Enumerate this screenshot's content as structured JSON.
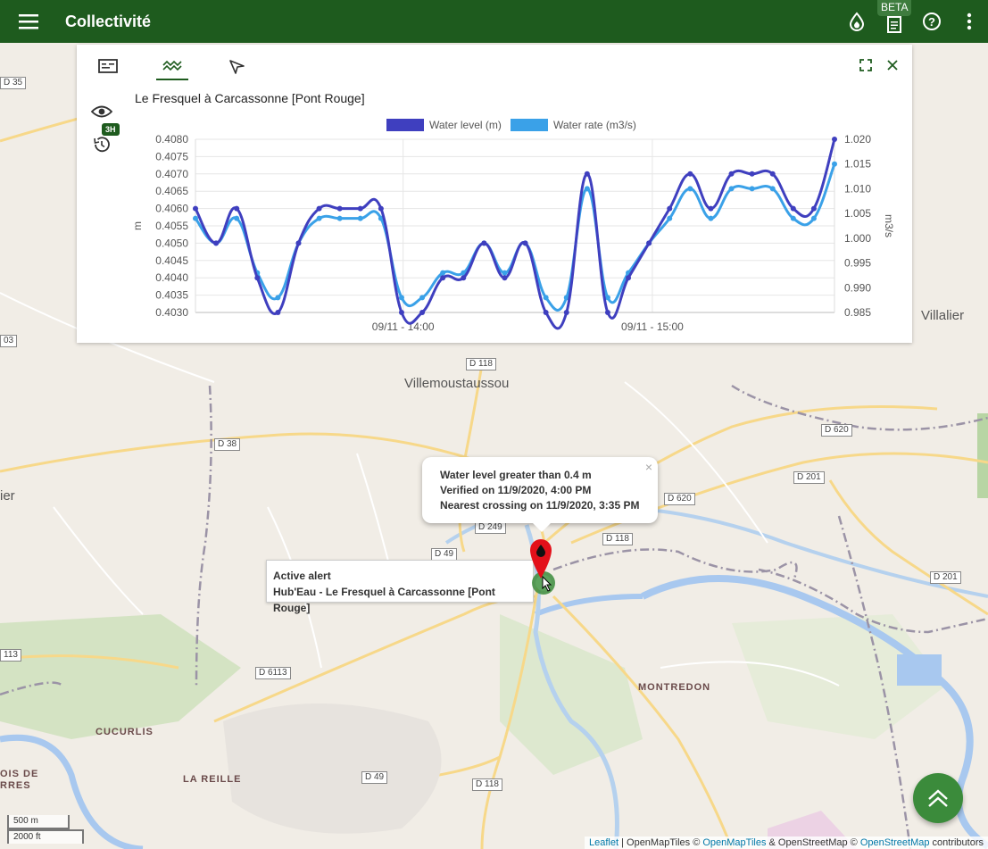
{
  "app": {
    "title": "Collectivité",
    "beta_label": "BETA"
  },
  "panel": {
    "station": "Le Fresquel à Carcassonne [Pont Rouge]",
    "history_badge": "3H"
  },
  "popup": {
    "line1": "Water level greater than 0.4 m",
    "line2": "Verified on 11/9/2020, 4:00 PM",
    "line3": "Nearest crossing on 11/9/2020, 3:35 PM",
    "close": "×"
  },
  "tooltip": {
    "line1": "Active alert",
    "line2": "Hub'Eau - Le Fresquel à Carcassonne [Pont Rouge]"
  },
  "map": {
    "places": {
      "villemoustaussou": "Villemoustaussou",
      "villalier": "Villalier",
      "montredon": "MONTREDON",
      "cucurlis": "CUCURLIS",
      "la_reille": "LA REILLE",
      "bois_de": "OIS DE",
      "barres": "RRES",
      "ier": "ier"
    },
    "roads": {
      "d35": "D 35",
      "d03": "03",
      "d118a": "D 118",
      "d38": "D 38",
      "d620a": "D 620",
      "d201a": "D 201",
      "d620b": "D 620",
      "d249": "D 249",
      "d118b": "D 118",
      "d49a": "D 49",
      "d201b": "D 201",
      "d113": "113",
      "d6113": "D 6113",
      "d49b": "D 49",
      "d118c": "D 118"
    },
    "scale_m": "500 m",
    "scale_ft": "2000 ft"
  },
  "attribution": {
    "leaflet": "Leaflet",
    "sep": " | OpenMapTiles © ",
    "omt": "OpenMapTiles",
    "amp": " & OpenStreetMap © ",
    "osm": "OpenStreetMap",
    "tail": " contributors"
  },
  "chart_data": {
    "type": "line",
    "legend": [
      "Water level (m)",
      "Water rate (m3/s)"
    ],
    "ylabel_left": "m",
    "ylabel_right": "m3/s",
    "ylim_left": [
      0.403,
      0.408
    ],
    "ylim_right": [
      0.985,
      1.02
    ],
    "yticks_left": [
      "0.4080",
      "0.4075",
      "0.4070",
      "0.4065",
      "0.4060",
      "0.4055",
      "0.4050",
      "0.4045",
      "0.4040",
      "0.4035",
      "0.4030"
    ],
    "yticks_right": [
      "1.020",
      "1.015",
      "1.010",
      "1.005",
      "1.000",
      "0.995",
      "0.990",
      "0.985"
    ],
    "xticks": [
      "09/11 - 14:00",
      "09/11 - 15:00"
    ],
    "colors": {
      "level": "#3f3fbf",
      "rate": "#3aa1e8"
    },
    "series": [
      {
        "name": "Water level (m)",
        "axis": "left",
        "values": [
          0.406,
          0.405,
          0.406,
          0.404,
          0.403,
          0.405,
          0.406,
          0.406,
          0.406,
          0.406,
          0.403,
          0.403,
          0.404,
          0.404,
          0.405,
          0.404,
          0.405,
          0.403,
          0.403,
          0.407,
          0.403,
          0.404,
          0.405,
          0.406,
          0.407,
          0.406,
          0.407,
          0.407,
          0.407,
          0.406,
          0.406,
          0.408
        ]
      },
      {
        "name": "Water rate (m3/s)",
        "axis": "right",
        "values": [
          1.004,
          0.999,
          1.004,
          0.993,
          0.988,
          0.999,
          1.004,
          1.004,
          1.004,
          1.004,
          0.988,
          0.988,
          0.993,
          0.993,
          0.999,
          0.993,
          0.999,
          0.988,
          0.988,
          1.01,
          0.988,
          0.993,
          0.999,
          1.004,
          1.01,
          1.004,
          1.01,
          1.01,
          1.01,
          1.004,
          1.004,
          1.015
        ]
      }
    ]
  }
}
